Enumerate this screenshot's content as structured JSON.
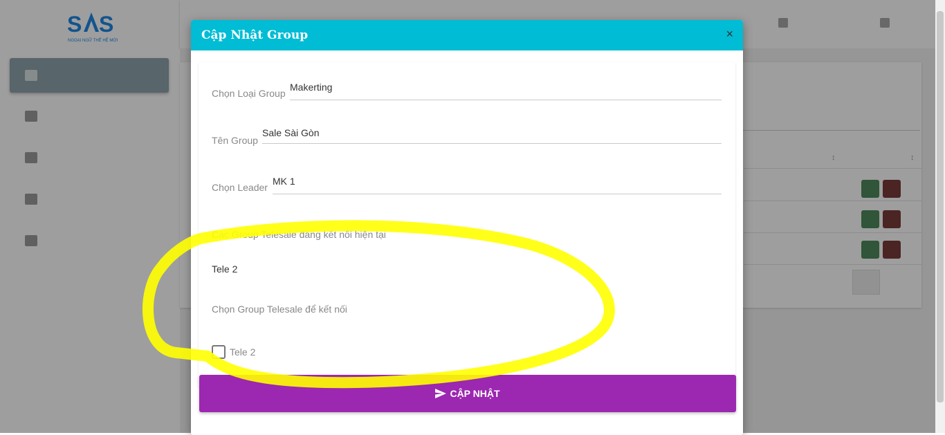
{
  "app": {
    "logo_text": "SAS",
    "logo_tagline": "NGOẠI NGỮ THẾ HỆ MỚI"
  },
  "modal": {
    "title": "Cập Nhật Group",
    "close_icon": "×",
    "fields": {
      "group_type": {
        "label": "Chọn Loại Group",
        "value": "Makerting"
      },
      "group_name": {
        "label": "Tên Group",
        "value": "Sale Sài Gòn"
      },
      "leader": {
        "label": "Chọn Leader",
        "value": "MK 1"
      }
    },
    "connected_heading": "Các Group Telesale đang kết nối hiện tại",
    "connected_groups": [
      "Tele 2"
    ],
    "choose_heading": "Chọn Group Telesale để kết nối",
    "options": [
      {
        "label": "Tele 2",
        "checked": false
      }
    ],
    "submit_label": "CẬP NHẬT",
    "submit_icon": "send-icon"
  },
  "colors": {
    "header": "#00bcd4",
    "submit": "#9c27b0",
    "highlight": "#ffff00"
  }
}
